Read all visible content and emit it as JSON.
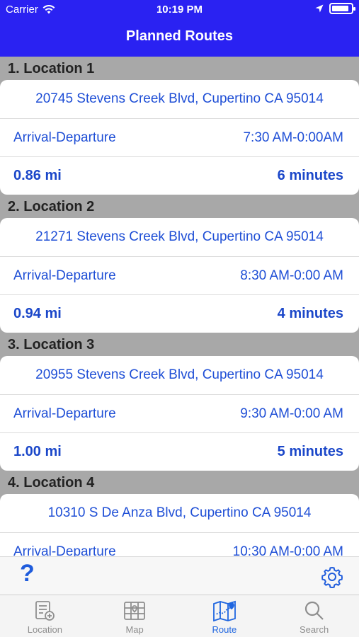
{
  "status": {
    "carrier": "Carrier",
    "time": "10:19 PM",
    "battery_level": 0.9
  },
  "nav": {
    "title": "Planned Routes"
  },
  "stops": [
    {
      "header": "1. Location 1",
      "address": "20745 Stevens Creek Blvd, Cupertino CA 95014",
      "ad_label": "Arrival-Departure",
      "ad_time": "7:30 AM-0:00AM",
      "distance": "0.86 mi",
      "duration": "6 minutes"
    },
    {
      "header": "2. Location 2",
      "address": "21271 Stevens Creek Blvd, Cupertino CA 95014",
      "ad_label": "Arrival-Departure",
      "ad_time": "8:30 AM-0:00 AM",
      "distance": "0.94 mi",
      "duration": "4 minutes"
    },
    {
      "header": "3. Location 3",
      "address": "20955 Stevens Creek Blvd, Cupertino CA 95014",
      "ad_label": "Arrival-Departure",
      "ad_time": "9:30 AM-0:00 AM",
      "distance": "1.00 mi",
      "duration": "5 minutes"
    },
    {
      "header": "4. Location 4",
      "address": "10310 S De Anza Blvd, Cupertino CA 95014",
      "ad_label": "Arrival-Departure",
      "ad_time": "10:30 AM-0:00 AM"
    }
  ],
  "toolbar": {
    "help_label": "?"
  },
  "tabs": [
    {
      "label": "Location",
      "icon": "location-list-icon"
    },
    {
      "label": "Map",
      "icon": "map-grid-icon"
    },
    {
      "label": "Route",
      "icon": "route-map-icon",
      "active": true
    },
    {
      "label": "Search",
      "icon": "search-icon"
    }
  ],
  "colors": {
    "nav_bar": "#2a22f2",
    "accent": "#1f66e0",
    "section_bg": "#a8a8a8"
  }
}
